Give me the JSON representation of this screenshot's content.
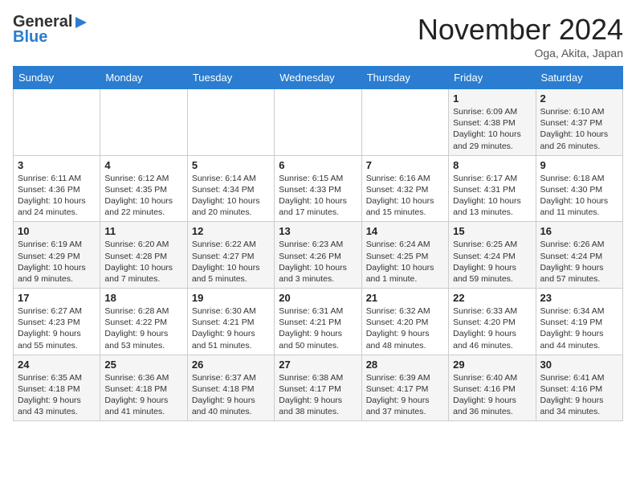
{
  "header": {
    "logo_line1": "General",
    "logo_line2": "Blue",
    "month_title": "November 2024",
    "location": "Oga, Akita, Japan"
  },
  "days_of_week": [
    "Sunday",
    "Monday",
    "Tuesday",
    "Wednesday",
    "Thursday",
    "Friday",
    "Saturday"
  ],
  "weeks": [
    [
      {
        "day": "",
        "info": ""
      },
      {
        "day": "",
        "info": ""
      },
      {
        "day": "",
        "info": ""
      },
      {
        "day": "",
        "info": ""
      },
      {
        "day": "",
        "info": ""
      },
      {
        "day": "1",
        "info": "Sunrise: 6:09 AM\nSunset: 4:38 PM\nDaylight: 10 hours and 29 minutes."
      },
      {
        "day": "2",
        "info": "Sunrise: 6:10 AM\nSunset: 4:37 PM\nDaylight: 10 hours and 26 minutes."
      }
    ],
    [
      {
        "day": "3",
        "info": "Sunrise: 6:11 AM\nSunset: 4:36 PM\nDaylight: 10 hours and 24 minutes."
      },
      {
        "day": "4",
        "info": "Sunrise: 6:12 AM\nSunset: 4:35 PM\nDaylight: 10 hours and 22 minutes."
      },
      {
        "day": "5",
        "info": "Sunrise: 6:14 AM\nSunset: 4:34 PM\nDaylight: 10 hours and 20 minutes."
      },
      {
        "day": "6",
        "info": "Sunrise: 6:15 AM\nSunset: 4:33 PM\nDaylight: 10 hours and 17 minutes."
      },
      {
        "day": "7",
        "info": "Sunrise: 6:16 AM\nSunset: 4:32 PM\nDaylight: 10 hours and 15 minutes."
      },
      {
        "day": "8",
        "info": "Sunrise: 6:17 AM\nSunset: 4:31 PM\nDaylight: 10 hours and 13 minutes."
      },
      {
        "day": "9",
        "info": "Sunrise: 6:18 AM\nSunset: 4:30 PM\nDaylight: 10 hours and 11 minutes."
      }
    ],
    [
      {
        "day": "10",
        "info": "Sunrise: 6:19 AM\nSunset: 4:29 PM\nDaylight: 10 hours and 9 minutes."
      },
      {
        "day": "11",
        "info": "Sunrise: 6:20 AM\nSunset: 4:28 PM\nDaylight: 10 hours and 7 minutes."
      },
      {
        "day": "12",
        "info": "Sunrise: 6:22 AM\nSunset: 4:27 PM\nDaylight: 10 hours and 5 minutes."
      },
      {
        "day": "13",
        "info": "Sunrise: 6:23 AM\nSunset: 4:26 PM\nDaylight: 10 hours and 3 minutes."
      },
      {
        "day": "14",
        "info": "Sunrise: 6:24 AM\nSunset: 4:25 PM\nDaylight: 10 hours and 1 minute."
      },
      {
        "day": "15",
        "info": "Sunrise: 6:25 AM\nSunset: 4:24 PM\nDaylight: 9 hours and 59 minutes."
      },
      {
        "day": "16",
        "info": "Sunrise: 6:26 AM\nSunset: 4:24 PM\nDaylight: 9 hours and 57 minutes."
      }
    ],
    [
      {
        "day": "17",
        "info": "Sunrise: 6:27 AM\nSunset: 4:23 PM\nDaylight: 9 hours and 55 minutes."
      },
      {
        "day": "18",
        "info": "Sunrise: 6:28 AM\nSunset: 4:22 PM\nDaylight: 9 hours and 53 minutes."
      },
      {
        "day": "19",
        "info": "Sunrise: 6:30 AM\nSunset: 4:21 PM\nDaylight: 9 hours and 51 minutes."
      },
      {
        "day": "20",
        "info": "Sunrise: 6:31 AM\nSunset: 4:21 PM\nDaylight: 9 hours and 50 minutes."
      },
      {
        "day": "21",
        "info": "Sunrise: 6:32 AM\nSunset: 4:20 PM\nDaylight: 9 hours and 48 minutes."
      },
      {
        "day": "22",
        "info": "Sunrise: 6:33 AM\nSunset: 4:20 PM\nDaylight: 9 hours and 46 minutes."
      },
      {
        "day": "23",
        "info": "Sunrise: 6:34 AM\nSunset: 4:19 PM\nDaylight: 9 hours and 44 minutes."
      }
    ],
    [
      {
        "day": "24",
        "info": "Sunrise: 6:35 AM\nSunset: 4:18 PM\nDaylight: 9 hours and 43 minutes."
      },
      {
        "day": "25",
        "info": "Sunrise: 6:36 AM\nSunset: 4:18 PM\nDaylight: 9 hours and 41 minutes."
      },
      {
        "day": "26",
        "info": "Sunrise: 6:37 AM\nSunset: 4:18 PM\nDaylight: 9 hours and 40 minutes."
      },
      {
        "day": "27",
        "info": "Sunrise: 6:38 AM\nSunset: 4:17 PM\nDaylight: 9 hours and 38 minutes."
      },
      {
        "day": "28",
        "info": "Sunrise: 6:39 AM\nSunset: 4:17 PM\nDaylight: 9 hours and 37 minutes."
      },
      {
        "day": "29",
        "info": "Sunrise: 6:40 AM\nSunset: 4:16 PM\nDaylight: 9 hours and 36 minutes."
      },
      {
        "day": "30",
        "info": "Sunrise: 6:41 AM\nSunset: 4:16 PM\nDaylight: 9 hours and 34 minutes."
      }
    ]
  ]
}
